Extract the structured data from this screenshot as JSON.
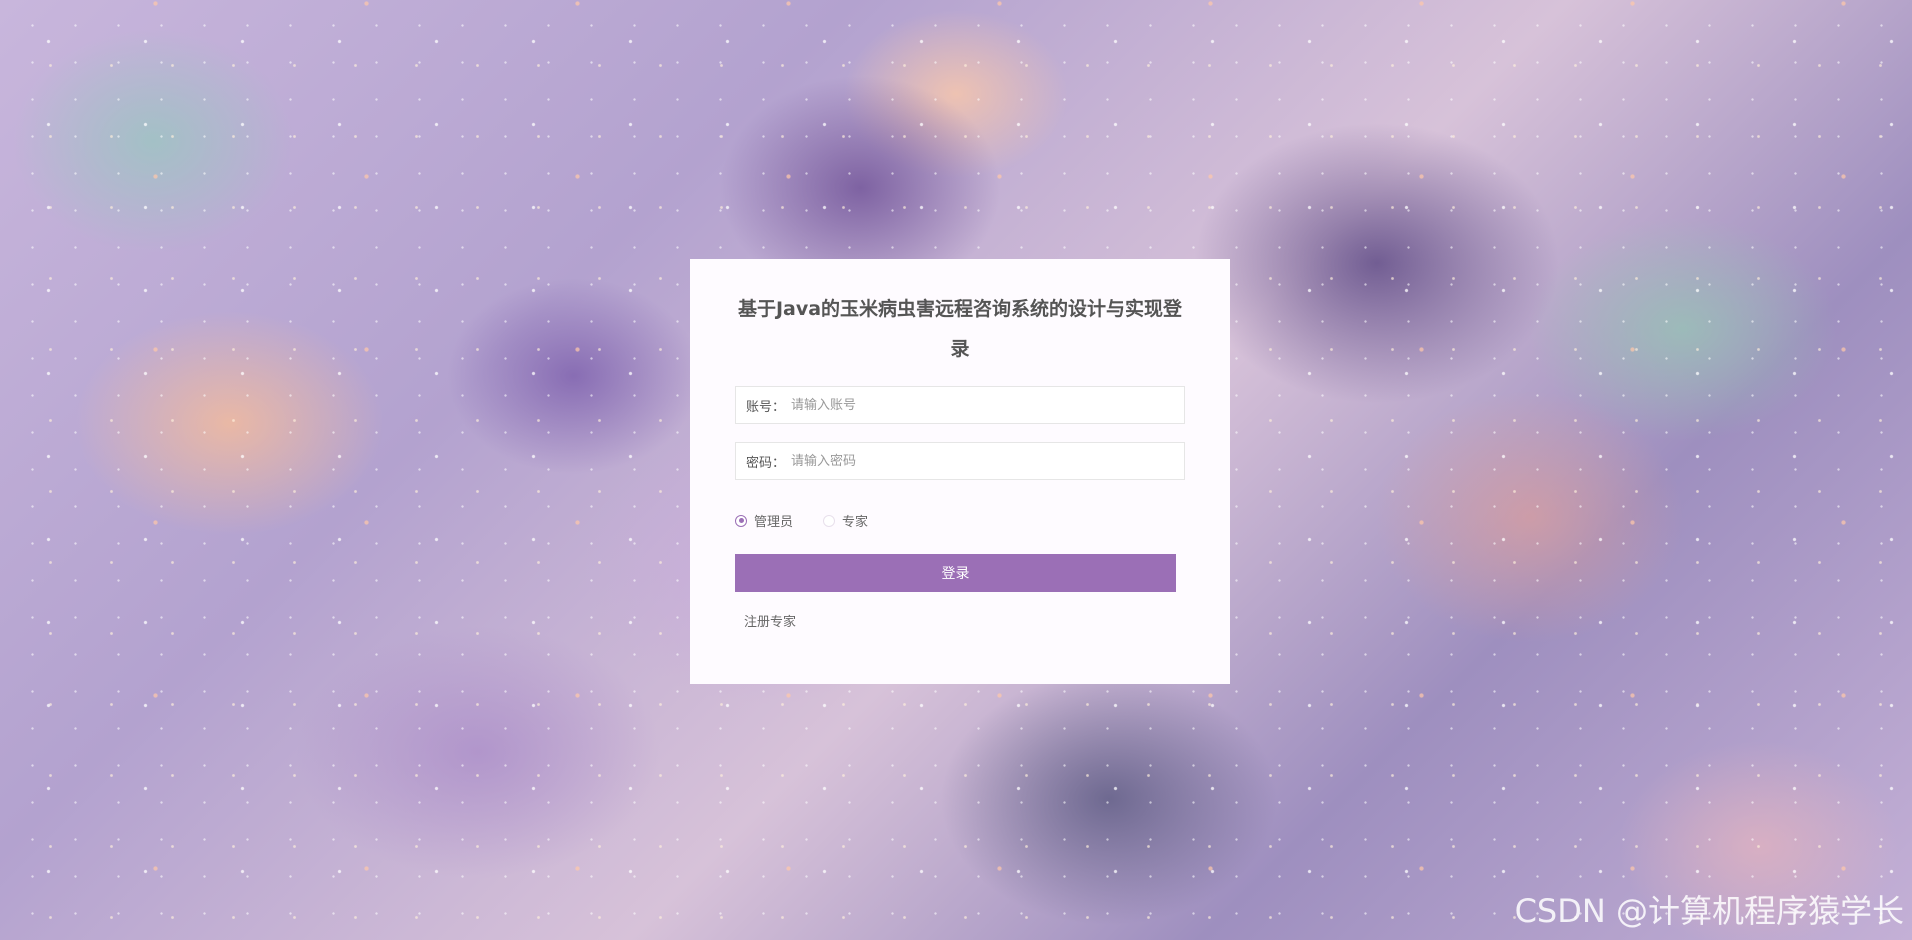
{
  "login": {
    "title": "基于Java的玉米病虫害远程咨询系统的设计与实现登录",
    "username": {
      "label": "账号：",
      "placeholder": "请输入账号",
      "value": ""
    },
    "password": {
      "label": "密码：",
      "placeholder": "请输入密码",
      "value": ""
    },
    "roles": [
      {
        "label": "管理员",
        "selected": true
      },
      {
        "label": "专家",
        "selected": false
      }
    ],
    "submit_label": "登录",
    "register_link": "注册专家"
  },
  "theme": {
    "accent": "#9b6fb6",
    "card_background": "#fefbff"
  },
  "watermark": "CSDN @计算机程序猿学长"
}
